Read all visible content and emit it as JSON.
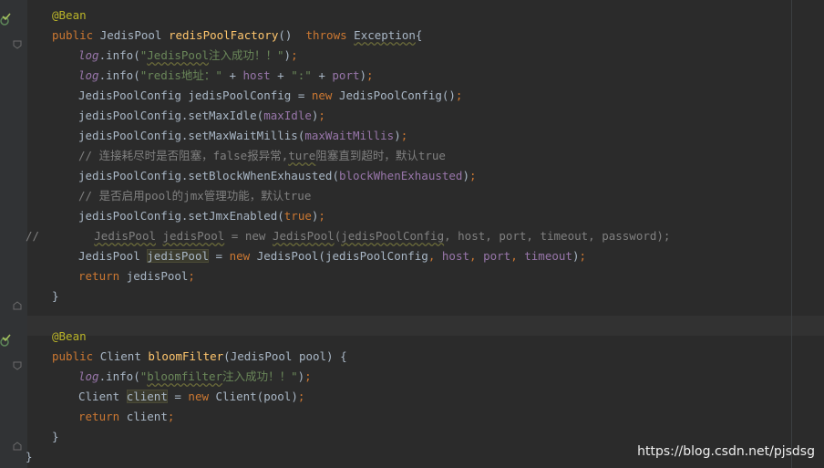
{
  "editor": {
    "lines": [
      {
        "tokens": [
          {
            "c": "t-ann",
            "t": "@Bean"
          }
        ]
      },
      {
        "tokens": [
          {
            "c": "t-kw",
            "t": "public "
          },
          {
            "c": "t-plain",
            "t": "JedisPool "
          },
          {
            "c": "t-fn",
            "t": "redisPoolFactory"
          },
          {
            "c": "t-plain",
            "t": "()  "
          },
          {
            "c": "t-kw",
            "t": "throws "
          },
          {
            "c": "t-plain wavy",
            "t": "Exception"
          },
          {
            "c": "t-plain",
            "t": "{"
          }
        ]
      },
      {
        "tokens": [
          {
            "c": "t-log",
            "t": "log"
          },
          {
            "c": "t-plain",
            "t": ".info("
          },
          {
            "c": "t-str",
            "t": "\""
          },
          {
            "c": "t-str wavy",
            "t": "JedisPool"
          },
          {
            "c": "t-str",
            "t": "注入成功！！\""
          },
          {
            "c": "t-plain",
            "t": ")"
          },
          {
            "c": "t-kw",
            "t": ";"
          }
        ]
      },
      {
        "tokens": [
          {
            "c": "t-log",
            "t": "log"
          },
          {
            "c": "t-plain",
            "t": ".info("
          },
          {
            "c": "t-str",
            "t": "\"redis地址：\" "
          },
          {
            "c": "t-plain",
            "t": "+ "
          },
          {
            "c": "t-field",
            "t": "host "
          },
          {
            "c": "t-plain",
            "t": "+ "
          },
          {
            "c": "t-str",
            "t": "\":\" "
          },
          {
            "c": "t-plain",
            "t": "+ "
          },
          {
            "c": "t-field",
            "t": "port"
          },
          {
            "c": "t-plain",
            "t": ")"
          },
          {
            "c": "t-kw",
            "t": ";"
          }
        ]
      },
      {
        "tokens": [
          {
            "c": "t-plain",
            "t": "JedisPoolConfig jedisPoolConfig = "
          },
          {
            "c": "t-kw",
            "t": "new "
          },
          {
            "c": "t-plain",
            "t": "JedisPoolConfig()"
          },
          {
            "c": "t-kw",
            "t": ";"
          }
        ]
      },
      {
        "tokens": [
          {
            "c": "t-plain",
            "t": "jedisPoolConfig.setMaxIdle("
          },
          {
            "c": "t-field",
            "t": "maxIdle"
          },
          {
            "c": "t-plain",
            "t": ")"
          },
          {
            "c": "t-kw",
            "t": ";"
          }
        ]
      },
      {
        "tokens": [
          {
            "c": "t-plain",
            "t": "jedisPoolConfig.setMaxWaitMillis("
          },
          {
            "c": "t-field",
            "t": "maxWaitMillis"
          },
          {
            "c": "t-plain",
            "t": ")"
          },
          {
            "c": "t-kw",
            "t": ";"
          }
        ]
      },
      {
        "tokens": [
          {
            "c": "t-com",
            "t": "// 连接耗尽时是否阻塞，false报异常,"
          },
          {
            "c": "t-com wavy",
            "t": "ture"
          },
          {
            "c": "t-com",
            "t": "阻塞直到超时，默认true"
          }
        ]
      },
      {
        "tokens": [
          {
            "c": "t-plain",
            "t": "jedisPoolConfig.setBlockWhenExhausted("
          },
          {
            "c": "t-field",
            "t": "blockWhenExhausted"
          },
          {
            "c": "t-plain",
            "t": ")"
          },
          {
            "c": "t-kw",
            "t": ";"
          }
        ]
      },
      {
        "tokens": [
          {
            "c": "t-com",
            "t": "// 是否启用pool的jmx管理功能，默认true"
          }
        ]
      },
      {
        "tokens": [
          {
            "c": "t-plain",
            "t": "jedisPoolConfig.setJmxEnabled("
          },
          {
            "c": "t-kw",
            "t": "true"
          },
          {
            "c": "t-plain",
            "t": ")"
          },
          {
            "c": "t-kw",
            "t": ";"
          }
        ]
      },
      {
        "tokens": [
          {
            "c": "t-com",
            "t": "//        "
          },
          {
            "c": "t-com wavy",
            "t": "JedisPool"
          },
          {
            "c": "t-com",
            "t": " "
          },
          {
            "c": "t-com wavy",
            "t": "jedisPool"
          },
          {
            "c": "t-com",
            "t": " = new "
          },
          {
            "c": "t-com wavy",
            "t": "JedisPool"
          },
          {
            "c": "t-com",
            "t": "("
          },
          {
            "c": "t-com wavy",
            "t": "jedisPoolConfig"
          },
          {
            "c": "t-com",
            "t": ", host, port, timeout, password);"
          }
        ]
      },
      {
        "tokens": [
          {
            "c": "t-plain",
            "t": "JedisPool "
          },
          {
            "c": "t-plain hl",
            "t": "jedisPool"
          },
          {
            "c": "t-plain",
            "t": " = "
          },
          {
            "c": "t-kw",
            "t": "new "
          },
          {
            "c": "t-plain",
            "t": "JedisPool(jedisPoolConfig"
          },
          {
            "c": "t-kw",
            "t": ", "
          },
          {
            "c": "t-field",
            "t": "host"
          },
          {
            "c": "t-kw",
            "t": ", "
          },
          {
            "c": "t-field",
            "t": "port"
          },
          {
            "c": "t-kw",
            "t": ", "
          },
          {
            "c": "t-field",
            "t": "timeout"
          },
          {
            "c": "t-plain",
            "t": ")"
          },
          {
            "c": "t-kw",
            "t": ";"
          }
        ]
      },
      {
        "tokens": [
          {
            "c": "t-kw",
            "t": "return "
          },
          {
            "c": "t-plain",
            "t": "jedisPool"
          },
          {
            "c": "t-kw",
            "t": ";"
          }
        ]
      },
      {
        "tokens": [
          {
            "c": "t-plain",
            "t": "}"
          }
        ]
      },
      {
        "tokens": []
      },
      {
        "tokens": [
          {
            "c": "t-ann",
            "t": "@Bean"
          }
        ]
      },
      {
        "tokens": [
          {
            "c": "t-kw",
            "t": "public "
          },
          {
            "c": "t-plain",
            "t": "Client "
          },
          {
            "c": "t-fn",
            "t": "bloomFilter"
          },
          {
            "c": "t-plain",
            "t": "(JedisPool pool) {"
          }
        ]
      },
      {
        "tokens": [
          {
            "c": "t-log",
            "t": "log"
          },
          {
            "c": "t-plain",
            "t": ".info("
          },
          {
            "c": "t-str",
            "t": "\""
          },
          {
            "c": "t-str wavy",
            "t": "bloomfilter"
          },
          {
            "c": "t-str",
            "t": "注入成功！！\""
          },
          {
            "c": "t-plain",
            "t": ")"
          },
          {
            "c": "t-kw",
            "t": ";"
          }
        ]
      },
      {
        "tokens": [
          {
            "c": "t-plain",
            "t": "Client "
          },
          {
            "c": "t-plain hl",
            "t": "client"
          },
          {
            "c": "t-plain",
            "t": " = "
          },
          {
            "c": "t-kw",
            "t": "new "
          },
          {
            "c": "t-plain",
            "t": "Client(pool)"
          },
          {
            "c": "t-kw",
            "t": ";"
          }
        ]
      },
      {
        "tokens": [
          {
            "c": "t-kw",
            "t": "return "
          },
          {
            "c": "t-plain",
            "t": "client"
          },
          {
            "c": "t-kw",
            "t": ";"
          }
        ]
      },
      {
        "tokens": [
          {
            "c": "t-plain",
            "t": "}"
          }
        ]
      },
      {
        "tokens": [
          {
            "c": "t-plain",
            "t": "}"
          }
        ]
      }
    ]
  },
  "watermark": "https://blog.csdn.net/pjsdsg",
  "colors": {
    "background": "#2b2b2b",
    "keyword": "#cc7832",
    "annotation": "#bbb529",
    "string": "#6a8759",
    "field": "#9876aa",
    "comment": "#808080",
    "method": "#ffc66d"
  }
}
